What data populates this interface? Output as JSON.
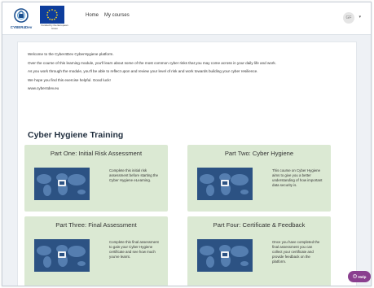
{
  "header": {
    "logo_text": "CYBER4Dev",
    "eu_caption": "Funded by the European Union",
    "nav": [
      {
        "label": "Home"
      },
      {
        "label": "My courses"
      }
    ],
    "avatar_initials": "GF"
  },
  "intro": {
    "paragraphs": [
      "Welcome to the Cyber4Dev CyberHygiene platform.",
      "Over the course of this learning module, you'll learn about some of the most common cyber risks that you may come across in your daily life and work.",
      "As you work through the module, you'll be able to reflect upon and review your level of risk and work towards building your cyber resilience.",
      "We hope you find this exercise helpful. Good luck!",
      "www.cyber4dev.eu"
    ]
  },
  "page": {
    "heading": "Cyber Hygiene Training"
  },
  "cards": [
    {
      "title": "Part One: Initial Risk Assessment",
      "description": "Complete this initial risk assessment before starting the Cyber Hygiene eLearning."
    },
    {
      "title": "Part Two: Cyber Hygiene",
      "description": "This course on Cyber Hygiene aims to give you a better understanding of how important data security is."
    },
    {
      "title": "Part Three: Final Assessment",
      "description": "Complete this final assessment to gain your Cyber Hygiene certificate and see how much you've learnt."
    },
    {
      "title": "Part Four: Certificate & Feedback",
      "description": "Once you have completed the final assessment you can collect your certificate and provide feedback on the platform."
    }
  ],
  "help": {
    "label": "Help",
    "icon": "question-circle-icon"
  },
  "colors": {
    "card_background": "#dbe9d3",
    "eu_blue": "#0d3d9c",
    "help_button": "#8a3f8f"
  }
}
